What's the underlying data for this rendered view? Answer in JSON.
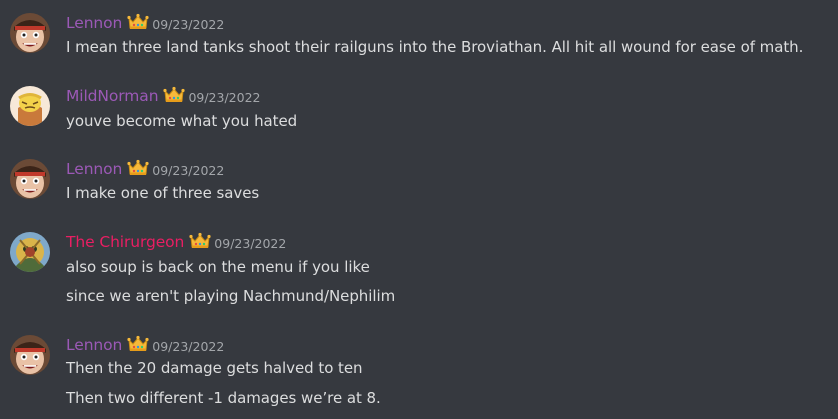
{
  "colors": {
    "background": "#36393f",
    "text": "#dcddde",
    "timestamp": "#a3a6aa",
    "role_purple": "#9b59b6",
    "role_red": "#e91e63"
  },
  "messages": [
    {
      "author": "Lennon",
      "author_color": "#9b59b6",
      "badge": "crown-icon",
      "timestamp": "09/23/2022",
      "lines": [
        "I mean three land tanks shoot their railguns into the Broviathan. All hit all wound for ease of math."
      ]
    },
    {
      "author": "MildNorman",
      "author_color": "#9b59b6",
      "badge": "crown-icon",
      "timestamp": "09/23/2022",
      "lines": [
        "youve become what you hated"
      ]
    },
    {
      "author": "Lennon",
      "author_color": "#9b59b6",
      "badge": "crown-icon",
      "timestamp": "09/23/2022",
      "lines": [
        "I make one of three saves"
      ]
    },
    {
      "author": "The Chirurgeon",
      "author_color": "#e91e63",
      "badge": "crown-icon",
      "timestamp": "09/23/2022",
      "lines": [
        "also soup is back on the menu if you like",
        "since we aren't playing Nachmund/Nephilim"
      ]
    },
    {
      "author": "Lennon",
      "author_color": "#9b59b6",
      "badge": "crown-icon",
      "timestamp": "09/23/2022",
      "lines": [
        "Then the 20 damage gets halved to ten",
        "Then two different -1 damages we’re at 8."
      ]
    }
  ]
}
